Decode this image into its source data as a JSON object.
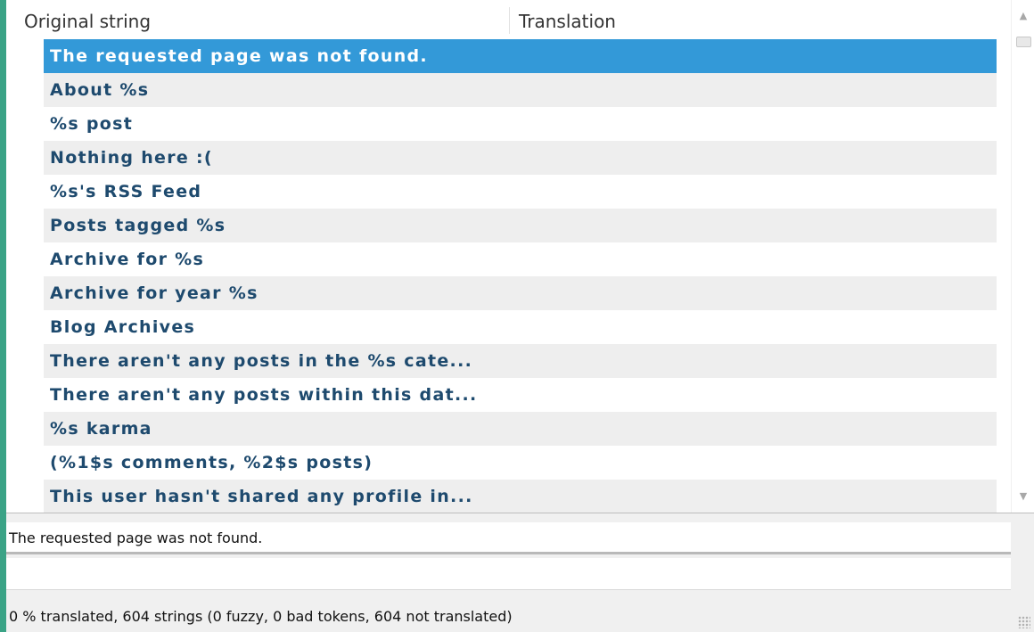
{
  "header": {
    "original": "Original string",
    "translation": "Translation"
  },
  "strings": [
    "The requested page was not found.",
    "About %s",
    "%s post",
    "Nothing here :(",
    "%s's RSS Feed",
    "Posts tagged %s",
    "Archive for %s",
    "Archive for year %s",
    "Blog Archives",
    "There aren't any posts in the %s cate...",
    "There aren't any posts within this dat...",
    "%s karma",
    "(%1$s comments, %2$s posts)",
    "This user hasn't shared any profile in..."
  ],
  "selected_index": 0,
  "source_text": "The requested page was not found.",
  "translation_text": "",
  "status": "0 % translated, 604 strings (0 fuzzy, 0 bad tokens, 604 not translated)",
  "icons": {
    "scroll_up": "scroll-up-arrow-icon",
    "scroll_down": "scroll-down-arrow-icon",
    "resize": "resize-grip-icon"
  },
  "colors": {
    "selection": "#3399d8",
    "string_text": "#1e4a6e"
  }
}
